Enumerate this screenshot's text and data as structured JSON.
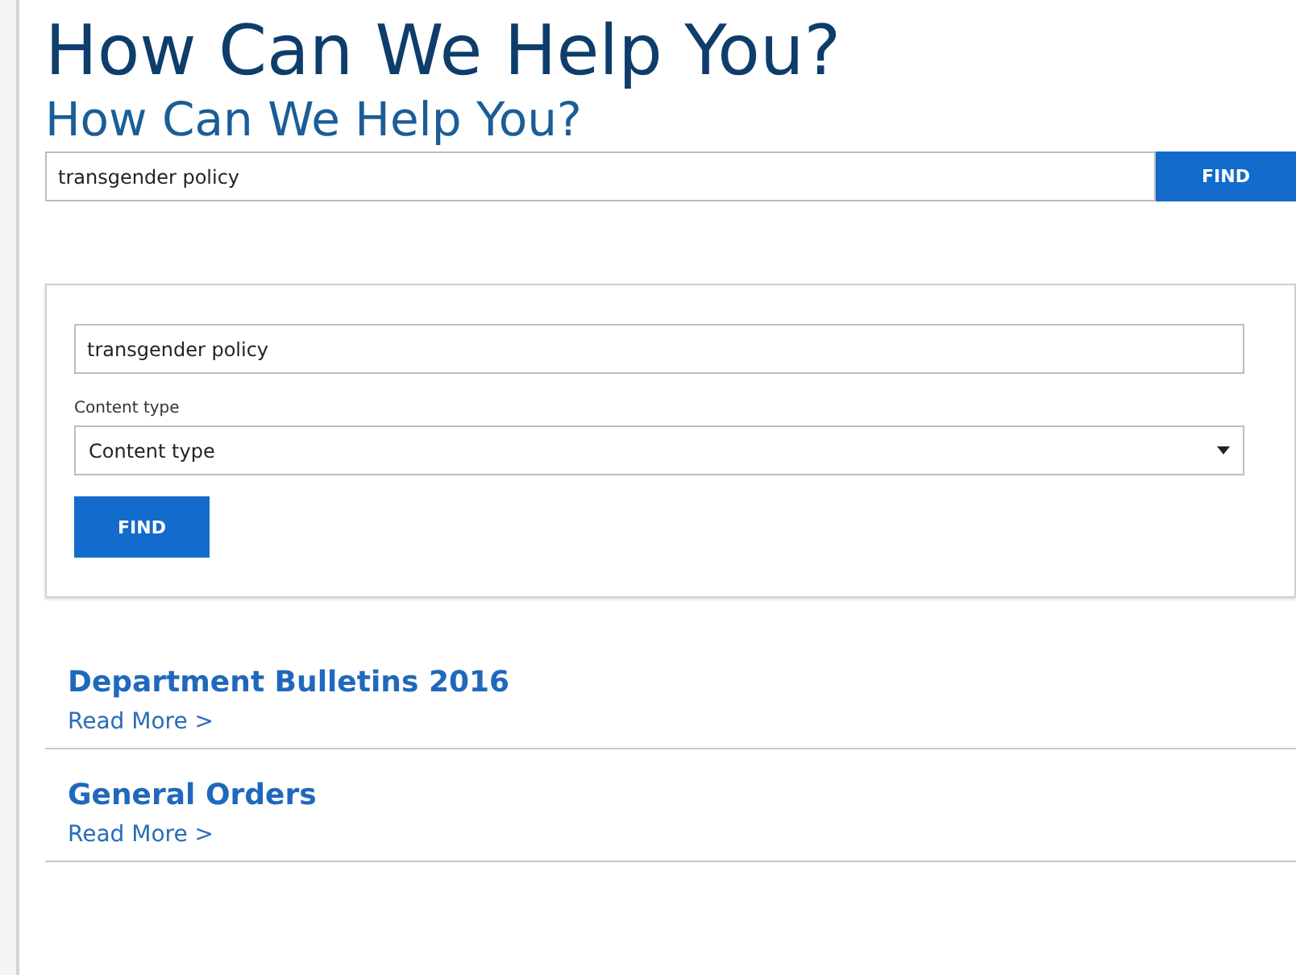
{
  "headings": [
    "How Can We Help You?",
    "How Can We Help You?"
  ],
  "search": {
    "value": "transgender policy",
    "button": "FIND"
  },
  "filter_form": {
    "query": "transgender policy",
    "content_type_label": "Content type",
    "content_type_value": "Content type",
    "button": "FIND"
  },
  "results": [
    {
      "title": "Department Bulletins 2016",
      "link": "Read More >"
    },
    {
      "title": "General Orders",
      "link": "Read More >"
    }
  ]
}
